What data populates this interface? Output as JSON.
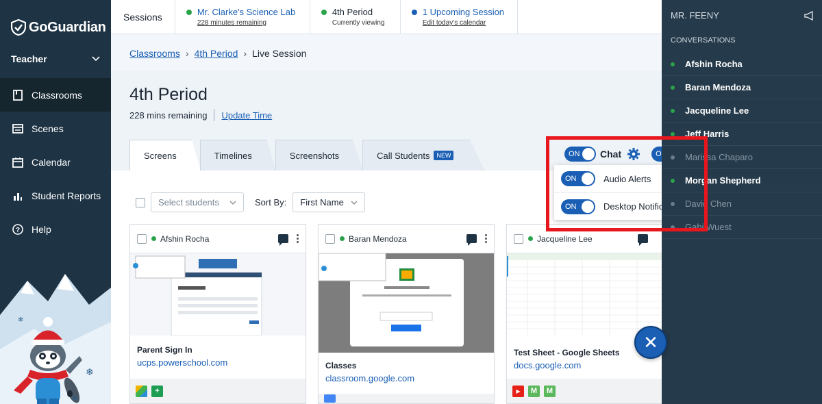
{
  "brand": {
    "name": "GoGuardian"
  },
  "sidebar": {
    "role": "Teacher",
    "items": [
      {
        "label": "Classrooms",
        "icon": "book-icon",
        "active": true
      },
      {
        "label": "Scenes",
        "icon": "scenes-icon"
      },
      {
        "label": "Calendar",
        "icon": "calendar-icon"
      },
      {
        "label": "Student Reports",
        "icon": "bar-chart-icon"
      },
      {
        "label": "Help",
        "icon": "help-icon"
      }
    ]
  },
  "topbar": {
    "sessions_label": "Sessions",
    "items": [
      {
        "title": "Mr. Clarke's Science Lab",
        "sub": "228 minutes remaining",
        "dot_color": "#2aa34a"
      },
      {
        "title": "4th Period",
        "sub": "Currently viewing",
        "dot_color": "#2aa34a"
      },
      {
        "title": "1 Upcoming Session",
        "sub": "Edit today's calendar",
        "dot_color": "#1a5fb4"
      }
    ]
  },
  "breadcrumb": {
    "items": [
      "Classrooms",
      "4th Period",
      "Live Session"
    ]
  },
  "page": {
    "title": "4th Period",
    "remaining": "228 mins remaining",
    "update_time": "Update Time"
  },
  "tabs": [
    {
      "label": "Screens",
      "active": true
    },
    {
      "label": "Timelines"
    },
    {
      "label": "Screenshots"
    },
    {
      "label": "Call Students",
      "badge": "NEW"
    }
  ],
  "filters": {
    "select_students_placeholder": "Select students",
    "sort_by_label": "Sort By:",
    "sort_by_value": "First Name"
  },
  "cards": [
    {
      "name": "Afshin Rocha",
      "title": "Parent Sign In",
      "url": "ucps.powerschool.com"
    },
    {
      "name": "Baran Mendoza",
      "title": "Classes",
      "url": "classroom.google.com"
    },
    {
      "name": "Jacqueline Lee",
      "title": "Test Sheet - Google Sheets",
      "url": "docs.google.com"
    }
  ],
  "chat_controls": {
    "toggle_on_label": "ON",
    "chat_label": "Chat",
    "audio_alerts": "Audio Alerts",
    "desktop_notifications": "Desktop Notifications"
  },
  "chat_panel": {
    "teacher": "MR. FEENY",
    "conversations_label": "CONVERSATIONS",
    "students": [
      {
        "name": "Afshin Rocha",
        "online": true
      },
      {
        "name": "Baran Mendoza",
        "online": true
      },
      {
        "name": "Jacqueline Lee",
        "online": true
      },
      {
        "name": "Jeff Harris",
        "online": true
      },
      {
        "name": "Marissa Chaparo",
        "online": false
      },
      {
        "name": "Morgan Shepherd",
        "online": true
      },
      {
        "name": "David Chen",
        "online": false
      },
      {
        "name": "Gabi Wuest",
        "online": false
      }
    ]
  },
  "colors": {
    "accent": "#1a5fb4",
    "online": "#2aa34a",
    "highlight": "#e8161d"
  }
}
